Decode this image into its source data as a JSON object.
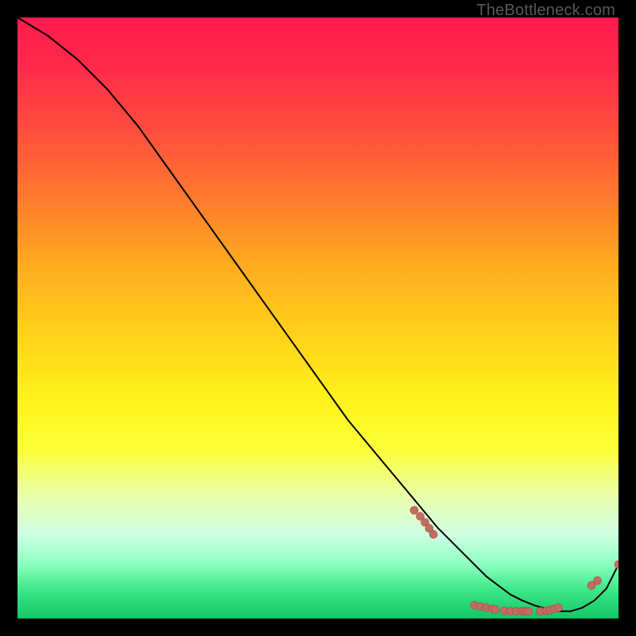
{
  "watermark": "TheBottleneck.com",
  "colors": {
    "curve": "#000000",
    "marker_fill": "#c46b62",
    "marker_stroke": "#9f4f47"
  },
  "chart_data": {
    "type": "line",
    "title": "",
    "xlabel": "",
    "ylabel": "",
    "xlim": [
      0,
      100
    ],
    "ylim": [
      0,
      100
    ],
    "grid": false,
    "legend": false,
    "series": [
      {
        "name": "curve",
        "x": [
          0,
          5,
          10,
          15,
          20,
          25,
          30,
          35,
          40,
          45,
          50,
          55,
          60,
          65,
          70,
          72,
          74,
          76,
          78,
          80,
          82,
          84,
          86,
          88,
          90,
          92,
          94,
          96,
          98,
          100
        ],
        "y": [
          100,
          97,
          93,
          88,
          82,
          75,
          68,
          61,
          54,
          47,
          40,
          33,
          27,
          21,
          15,
          13,
          11,
          9,
          7,
          5.5,
          4,
          3,
          2.2,
          1.6,
          1.2,
          1.2,
          1.8,
          3,
          5,
          9
        ]
      }
    ],
    "markers": [
      {
        "x": 66,
        "y": 18
      },
      {
        "x": 67,
        "y": 17
      },
      {
        "x": 67.8,
        "y": 16
      },
      {
        "x": 68.5,
        "y": 15
      },
      {
        "x": 69.2,
        "y": 14
      },
      {
        "x": 76,
        "y": 2.2
      },
      {
        "x": 77,
        "y": 2.0
      },
      {
        "x": 78,
        "y": 1.8
      },
      {
        "x": 79,
        "y": 1.6
      },
      {
        "x": 79.5,
        "y": 1.5
      },
      {
        "x": 81,
        "y": 1.3
      },
      {
        "x": 82,
        "y": 1.2
      },
      {
        "x": 83,
        "y": 1.2
      },
      {
        "x": 84,
        "y": 1.2
      },
      {
        "x": 84.5,
        "y": 1.2
      },
      {
        "x": 85,
        "y": 1.2
      },
      {
        "x": 87,
        "y": 1.2
      },
      {
        "x": 88,
        "y": 1.3
      },
      {
        "x": 88.6,
        "y": 1.4
      },
      {
        "x": 89.3,
        "y": 1.6
      },
      {
        "x": 90,
        "y": 1.8
      },
      {
        "x": 95.5,
        "y": 5.5
      },
      {
        "x": 96.5,
        "y": 6.3
      },
      {
        "x": 100,
        "y": 9
      }
    ]
  }
}
